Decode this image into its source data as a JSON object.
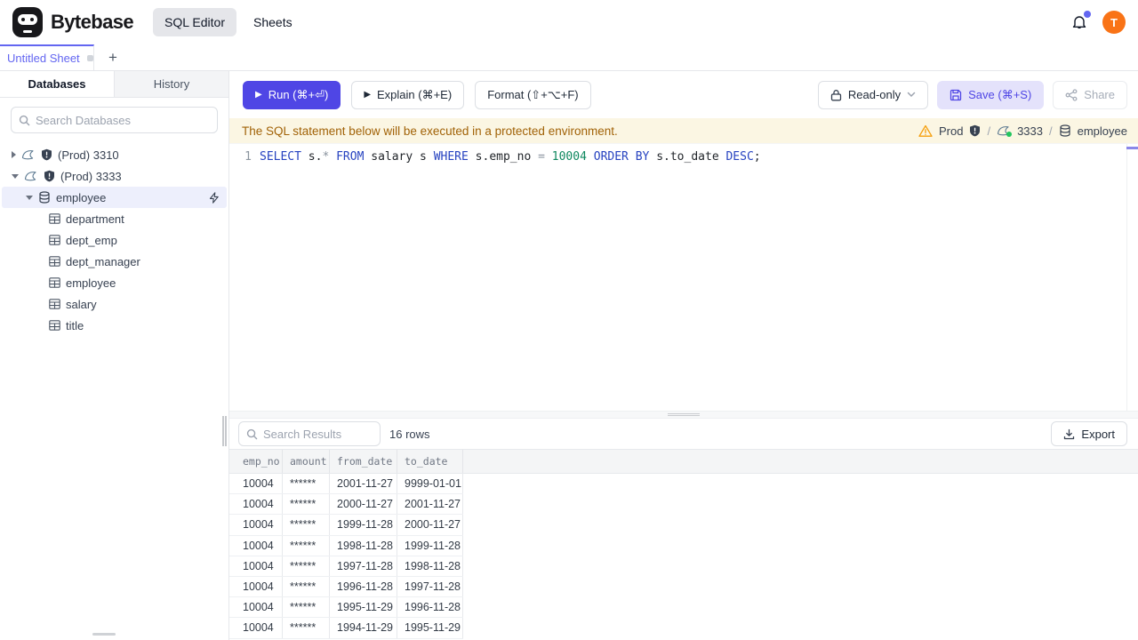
{
  "header": {
    "brand": "Bytebase",
    "nav": [
      {
        "label": "SQL Editor",
        "active": true
      },
      {
        "label": "Sheets",
        "active": false
      }
    ],
    "avatar_text": "T",
    "accent_color": "#4f46e5",
    "avatar_color": "#f97316"
  },
  "tabs": {
    "active_tab": "Untitled Sheet",
    "new_tab_label": "+"
  },
  "sidebar": {
    "tabs": [
      {
        "label": "Databases",
        "active": true
      },
      {
        "label": "History",
        "active": false
      }
    ],
    "search_placeholder": "Search Databases",
    "tree": {
      "instances": [
        {
          "label": "(Prod) 3310",
          "expanded": false
        },
        {
          "label": "(Prod) 3333",
          "expanded": true
        }
      ],
      "database": {
        "label": "employee",
        "selected": true
      },
      "tables": [
        "department",
        "dept_emp",
        "dept_manager",
        "employee",
        "salary",
        "title"
      ]
    }
  },
  "toolbar": {
    "run_label": "Run (⌘+⏎)",
    "explain_label": "Explain (⌘+E)",
    "format_label": "Format (⇧+⌥+F)",
    "readonly_label": "Read-only",
    "save_label": "Save (⌘+S)",
    "share_label": "Share"
  },
  "banner": {
    "message": "The SQL statement below will be executed in a protected environment.",
    "environment": "Prod",
    "instance": "3333",
    "database": "employee",
    "separator": "/"
  },
  "editor": {
    "line_number": "1",
    "sql": "SELECT s.* FROM salary s WHERE s.emp_no = 10004 ORDER BY s.to_date DESC;",
    "tokens": [
      {
        "t": "SELECT ",
        "c": "kw"
      },
      {
        "t": "s.",
        "c": "id"
      },
      {
        "t": "*",
        "c": "op"
      },
      {
        "t": " ",
        "c": "id"
      },
      {
        "t": "FROM ",
        "c": "kw"
      },
      {
        "t": "salary s ",
        "c": "id"
      },
      {
        "t": "WHERE ",
        "c": "kw"
      },
      {
        "t": "s.emp_no ",
        "c": "id"
      },
      {
        "t": "= ",
        "c": "op"
      },
      {
        "t": "10004 ",
        "c": "num"
      },
      {
        "t": "ORDER BY ",
        "c": "kw"
      },
      {
        "t": "s.to_date ",
        "c": "id"
      },
      {
        "t": "DESC",
        "c": "kw"
      },
      {
        "t": ";",
        "c": "id"
      }
    ]
  },
  "results": {
    "search_placeholder": "Search Results",
    "row_count": "16 rows",
    "export_label": "Export",
    "table": {
      "columns": [
        "emp_no",
        "amount",
        "from_date",
        "to_date"
      ],
      "rows": [
        {
          "emp_no": "10004",
          "amount": "******",
          "from_date": "2001-11-27",
          "to_date": "9999-01-01"
        },
        {
          "emp_no": "10004",
          "amount": "******",
          "from_date": "2000-11-27",
          "to_date": "2001-11-27"
        },
        {
          "emp_no": "10004",
          "amount": "******",
          "from_date": "1999-11-28",
          "to_date": "2000-11-27"
        },
        {
          "emp_no": "10004",
          "amount": "******",
          "from_date": "1998-11-28",
          "to_date": "1999-11-28"
        },
        {
          "emp_no": "10004",
          "amount": "******",
          "from_date": "1997-11-28",
          "to_date": "1998-11-28"
        },
        {
          "emp_no": "10004",
          "amount": "******",
          "from_date": "1996-11-28",
          "to_date": "1997-11-28"
        },
        {
          "emp_no": "10004",
          "amount": "******",
          "from_date": "1995-11-29",
          "to_date": "1996-11-28"
        },
        {
          "emp_no": "10004",
          "amount": "******",
          "from_date": "1994-11-29",
          "to_date": "1995-11-29"
        }
      ]
    }
  }
}
